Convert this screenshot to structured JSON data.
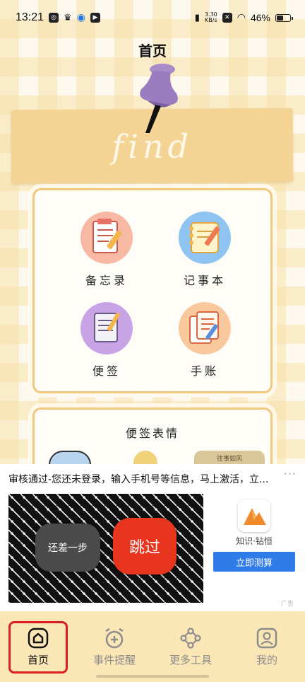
{
  "status_bar": {
    "time": "13:21",
    "net_speed_value": "3.30",
    "net_speed_unit": "KB/s",
    "battery": "46%"
  },
  "page": {
    "title": "首页",
    "banner_word": "find"
  },
  "tools": [
    {
      "label": "备忘录",
      "icon": "memo-icon"
    },
    {
      "label": "记事本",
      "icon": "notebook-icon"
    },
    {
      "label": "便签",
      "icon": "sticky-note-icon"
    },
    {
      "label": "手账",
      "icon": "journal-icon"
    }
  ],
  "stickers_card": {
    "title": "便签表情",
    "peek_label": "往事如风"
  },
  "ad": {
    "text": "审核通过-您还未登录，输入手机号等信息，马上激活，立...",
    "more": "···",
    "back_button": "还差一步",
    "skip_button": "跳过",
    "brand": "知识·钻恒",
    "cta": "立即测算",
    "mark": "广告"
  },
  "bottom_nav": [
    {
      "label": "首页",
      "icon": "home-icon",
      "active": true
    },
    {
      "label": "事件提醒",
      "icon": "alarm-clock-icon",
      "active": false
    },
    {
      "label": "更多工具",
      "icon": "share-tools-icon",
      "active": false
    },
    {
      "label": "我的",
      "icon": "profile-icon",
      "active": false
    }
  ],
  "colors": {
    "accent": "#f2c87c",
    "banner": "#f4d495",
    "nav_bg": "#fbe6b6",
    "cta_blue": "#2f7be8",
    "skip_red": "#e8361e",
    "highlight_red": "#d81e1e"
  }
}
